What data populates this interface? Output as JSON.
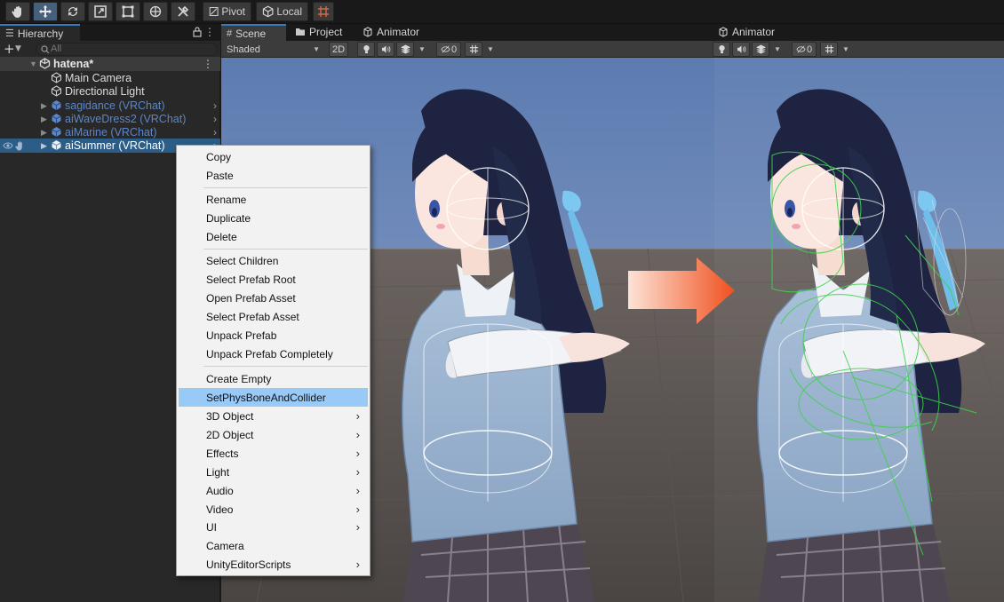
{
  "toolbar": {
    "pivot_label": "Pivot",
    "local_label": "Local"
  },
  "hierarchy": {
    "tab_label": "Hierarchy",
    "search_placeholder": "All",
    "scene_name": "hatena*",
    "items": [
      {
        "label": "Main Camera",
        "style": "normal"
      },
      {
        "label": "Directional Light",
        "style": "normal"
      },
      {
        "label": "sagidance (VRChat)",
        "style": "prefab"
      },
      {
        "label": "aiWaveDress2 (VRChat)",
        "style": "prefab"
      },
      {
        "label": "aiMarine (VRChat)",
        "style": "prefab"
      },
      {
        "label": "aiSummer (VRChat)",
        "style": "selected"
      }
    ]
  },
  "scene": {
    "tabs": [
      {
        "label": "Scene",
        "icon": "grid-icon"
      },
      {
        "label": "Project",
        "icon": "folder-icon"
      },
      {
        "label": "Animator",
        "icon": "animator-icon"
      }
    ],
    "right_tab": "Animator",
    "shading_mode": "Shaded",
    "mode_2d": "2D",
    "hidden_count": "0"
  },
  "context_menu": {
    "items": [
      {
        "label": "Copy"
      },
      {
        "label": "Paste"
      },
      {
        "label": "Rename"
      },
      {
        "label": "Duplicate"
      },
      {
        "label": "Delete"
      },
      {
        "label": "Select Children"
      },
      {
        "label": "Select Prefab Root"
      },
      {
        "label": "Open Prefab Asset"
      },
      {
        "label": "Select Prefab Asset"
      },
      {
        "label": "Unpack Prefab"
      },
      {
        "label": "Unpack Prefab Completely"
      },
      {
        "label": "Create Empty"
      },
      {
        "label": "SetPhysBoneAndCollider",
        "highlighted": true
      },
      {
        "label": "3D Object",
        "submenu": true
      },
      {
        "label": "2D Object",
        "submenu": true
      },
      {
        "label": "Effects",
        "submenu": true
      },
      {
        "label": "Light",
        "submenu": true
      },
      {
        "label": "Audio",
        "submenu": true
      },
      {
        "label": "Video",
        "submenu": true
      },
      {
        "label": "UI",
        "submenu": true
      },
      {
        "label": "Camera"
      },
      {
        "label": "UnityEditorScripts",
        "submenu": true
      }
    ]
  },
  "colors": {
    "selection": "#2c5d87",
    "menu_highlight": "#99c9f7",
    "arrow_start": "#fde3d6",
    "arrow_end": "#f0501e",
    "prefab_text": "#5b86c8"
  }
}
